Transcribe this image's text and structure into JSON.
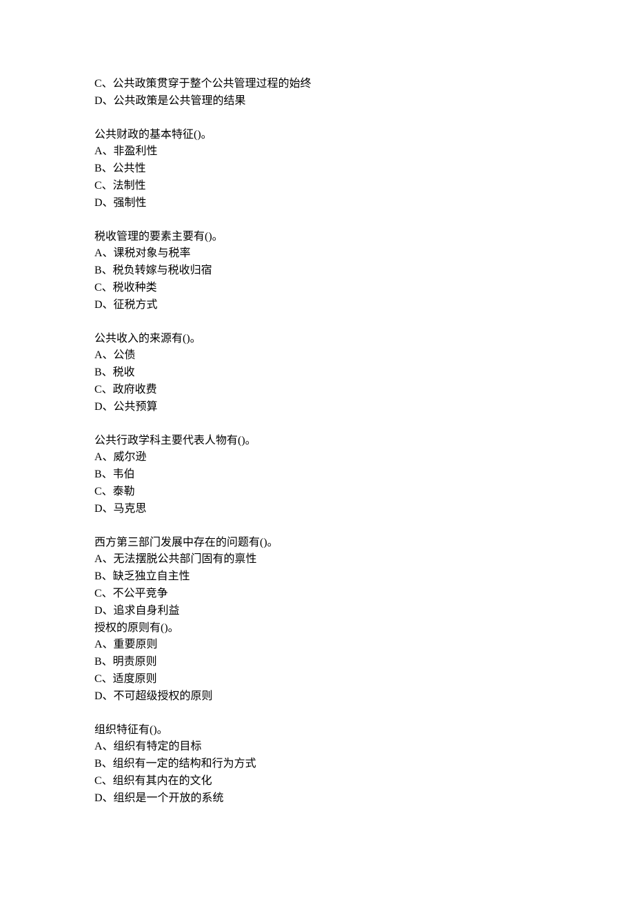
{
  "continuation": {
    "options": [
      "C、公共政策贯穿于整个公共管理过程的始终",
      "D、公共政策是公共管理的结果"
    ]
  },
  "questions": [
    {
      "stem": "公共财政的基本特征()。",
      "options": [
        "A、非盈利性",
        "B、公共性",
        "C、法制性",
        "D、强制性"
      ]
    },
    {
      "stem": "税收管理的要素主要有()。",
      "options": [
        "A、课税对象与税率",
        "B、税负转嫁与税收归宿",
        "C、税收种类",
        "D、征税方式"
      ]
    },
    {
      "stem": "公共收入的来源有()。",
      "options": [
        "A、公债",
        "B、税收",
        "C、政府收费",
        "D、公共预算"
      ]
    },
    {
      "stem": "公共行政学科主要代表人物有()。",
      "options": [
        "A、威尔逊",
        "B、韦伯",
        "C、泰勒",
        "D、马克思"
      ]
    },
    {
      "stem": "西方第三部门发展中存在的问题有()。",
      "options": [
        "A、无法摆脱公共部门固有的禀性",
        "B、缺乏独立自主性",
        "C、不公平竞争",
        "D、追求自身利益"
      ]
    },
    {
      "stem": "授权的原则有()。",
      "options": [
        "A、重要原则",
        "B、明责原则",
        "C、适度原则",
        "D、不可超级授权的原则"
      ]
    },
    {
      "stem": "组织特征有()。",
      "options": [
        "A、组织有特定的目标",
        "B、组织有一定的结构和行为方式",
        "C、组织有其内在的文化",
        "D、组织是一个开放的系统"
      ]
    }
  ]
}
